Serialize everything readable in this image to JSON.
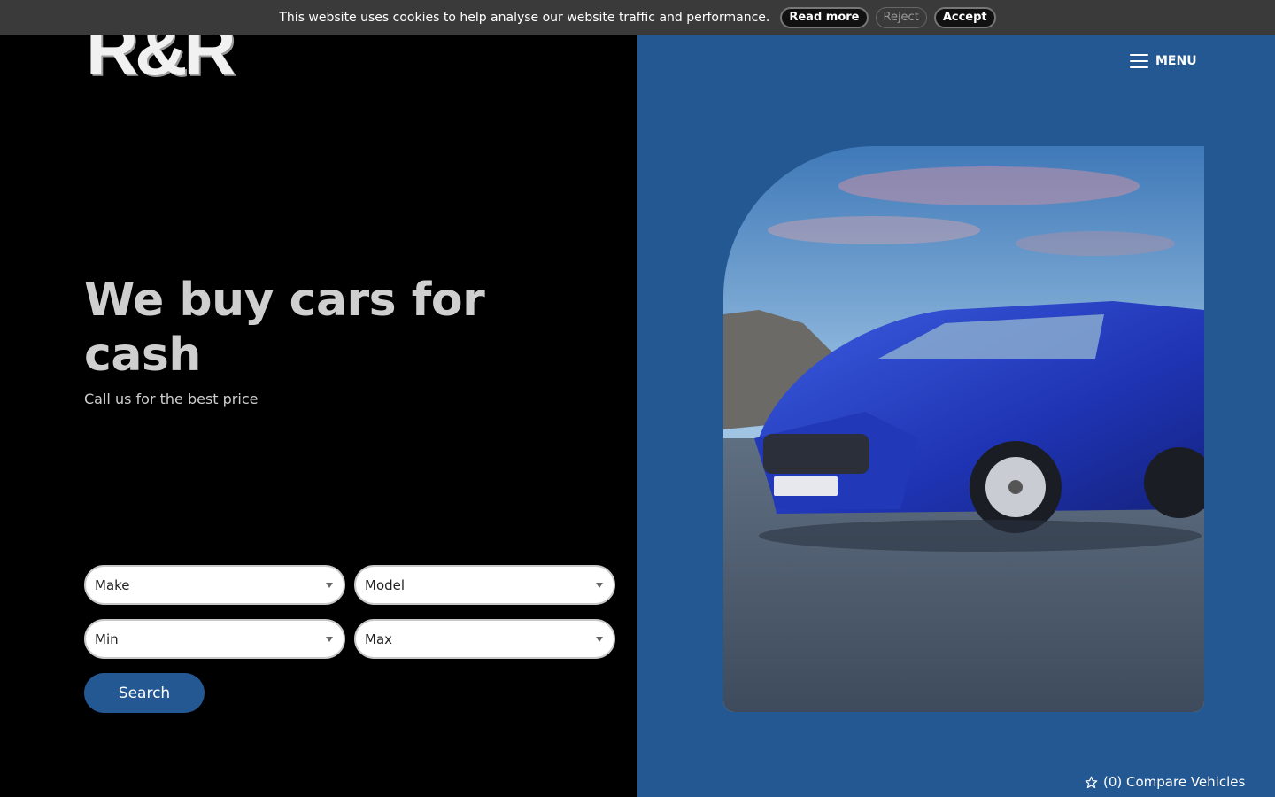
{
  "cookie_bar": {
    "message": "This website uses cookies to help analyse our website traffic and performance.",
    "read_more_label": "Read more",
    "reject_label": "Reject",
    "accept_label": "Accept"
  },
  "header": {
    "logo_text": "R&R",
    "menu_label": "MENU",
    "menu_icon": "hamburger-icon"
  },
  "hero": {
    "title": "We buy cars for cash",
    "subtitle": "Call us for the best price"
  },
  "search_form": {
    "make_label": "Make",
    "model_label": "Model",
    "min_label": "Min",
    "max_label": "Max",
    "search_label": "Search"
  },
  "compare": {
    "label": "(0) Compare Vehicles",
    "icon": "star-icon"
  },
  "colors": {
    "brand_blue": "#235893",
    "background": "#000000",
    "cookie_bar": "#3a3a3a",
    "hero_text": "#cfcfcf"
  }
}
